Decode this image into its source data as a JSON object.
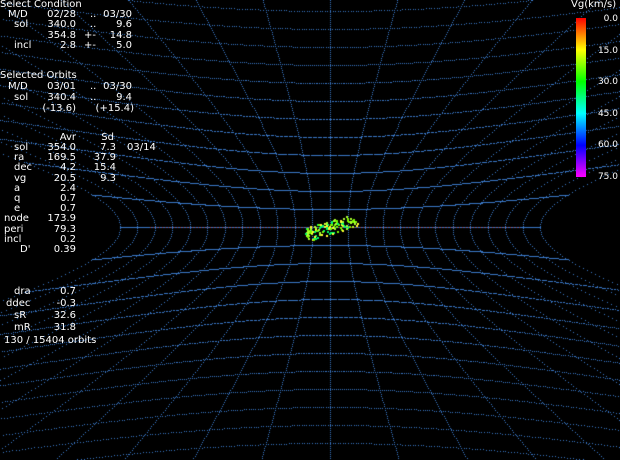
{
  "select_condition": {
    "title": "Select Condition",
    "md": {
      "label": "M/D",
      "from": "02/28",
      "dots": "..",
      "to": "03/30"
    },
    "sol1": {
      "label": "sol",
      "from": "340.0",
      "dots": "..",
      "to": "9.6"
    },
    "sol2": {
      "label": "",
      "from": "354.8",
      "pm": "+-",
      "to": "14.8"
    },
    "incl": {
      "label": "incl",
      "from": "2.8",
      "pm": "+-",
      "to": "5.0"
    }
  },
  "selected_orbits": {
    "title": "Selected Orbits",
    "md": {
      "label": "M/D",
      "from": "03/01",
      "dots": "..",
      "to": "03/30"
    },
    "sol": {
      "label": "sol",
      "from": "340.4",
      "dots": "..",
      "to": "9.4"
    },
    "range": {
      "from": "(-13.6)",
      "to": "(+15.4)"
    }
  },
  "stats": {
    "header_avr": "Avr",
    "header_sd": "Sd",
    "rows": [
      {
        "label": "sol",
        "avr": "354.0",
        "sd": "7.3",
        "extra": "03/14"
      },
      {
        "label": "ra",
        "avr": "169.5",
        "sd": "37.9",
        "extra": ""
      },
      {
        "label": "dec",
        "avr": "4.2",
        "sd": "15.4",
        "extra": ""
      },
      {
        "label": "vg",
        "avr": "20.5",
        "sd": "9.3",
        "extra": ""
      },
      {
        "label": "a",
        "avr": "2.4",
        "sd": "",
        "extra": ""
      },
      {
        "label": "q",
        "avr": "0.7",
        "sd": "",
        "extra": ""
      },
      {
        "label": "e",
        "avr": "0.7",
        "sd": "",
        "extra": ""
      },
      {
        "label": "node",
        "avr": "173.9",
        "sd": "",
        "extra": ""
      },
      {
        "label": "peri",
        "avr": "79.3",
        "sd": "",
        "extra": ""
      },
      {
        "label": "incl",
        "avr": "0.2",
        "sd": "",
        "extra": ""
      },
      {
        "label": "D'",
        "avr": "0.39",
        "sd": "",
        "extra": ""
      }
    ],
    "rows2": [
      {
        "label": "dra",
        "avr": "0.7"
      },
      {
        "label": "ddec",
        "avr": "-0.3"
      },
      {
        "label": "sR",
        "avr": "32.6"
      },
      {
        "label": "mR",
        "avr": "31.8"
      }
    ],
    "orbit_count": "130 / 15404 orbits"
  },
  "legend": {
    "title": "Vg(km/s)",
    "ticks": [
      "0.0",
      "15.0",
      "30.0",
      "45.0",
      "60.0",
      "75.0"
    ],
    "gradient_colors": [
      "#ff0000",
      "#ffff00",
      "#00ff00",
      "#00ffff",
      "#0000ff",
      "#ff00ff"
    ]
  },
  "plot": {
    "grid_color": "#3a78c8",
    "baseline_color": "#b03a2e",
    "point_colors": [
      "#7cfc00",
      "#adff2f",
      "#00ff66",
      "#ffff33"
    ]
  }
}
